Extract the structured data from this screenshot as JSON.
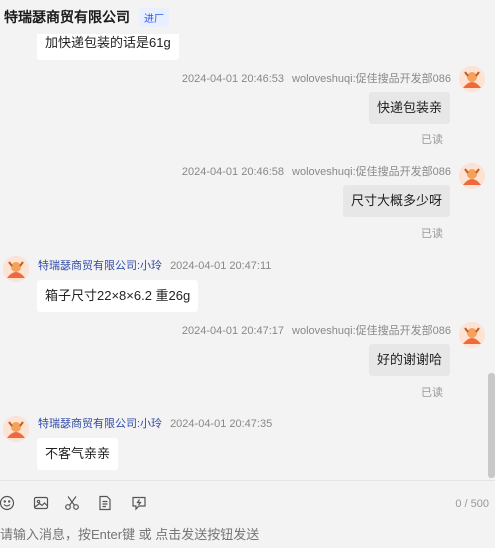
{
  "header": {
    "title": "特瑞瑟商贸有限公司",
    "badge": "进厂"
  },
  "messages": {
    "m0": {
      "text": "加快递包装的话是61g"
    },
    "m1": {
      "time": "2024-04-01 20:46:53",
      "sender": "woloveshuqi:促佳搜品开发部086",
      "text": "快递包装亲",
      "status": "已读"
    },
    "m2": {
      "time": "2024-04-01 20:46:58",
      "sender": "woloveshuqi:促佳搜品开发部086",
      "text": "尺寸大概多少呀",
      "status": "已读"
    },
    "m3": {
      "name": "特瑞瑟商贸有限公司:小玲",
      "time": "2024-04-01 20:47:11",
      "text": "箱子尺寸22×8×6.2    重26g"
    },
    "m4": {
      "time": "2024-04-01 20:47:17",
      "sender": "woloveshuqi:促佳搜品开发部086",
      "text": "好的谢谢哈",
      "status": "已读"
    },
    "m5": {
      "name": "特瑞瑟商贸有限公司:小玲",
      "time": "2024-04-01 20:47:35",
      "text": "不客气亲亲"
    }
  },
  "toolbar": {
    "icons": [
      "emoji-icon",
      "image-icon",
      "scissors-icon",
      "document-icon",
      "quick-reply-icon"
    ],
    "counter": "0 / 500"
  },
  "input": {
    "placeholder": "请输入消息，按Enter键 或 点击发送按钮发送"
  }
}
